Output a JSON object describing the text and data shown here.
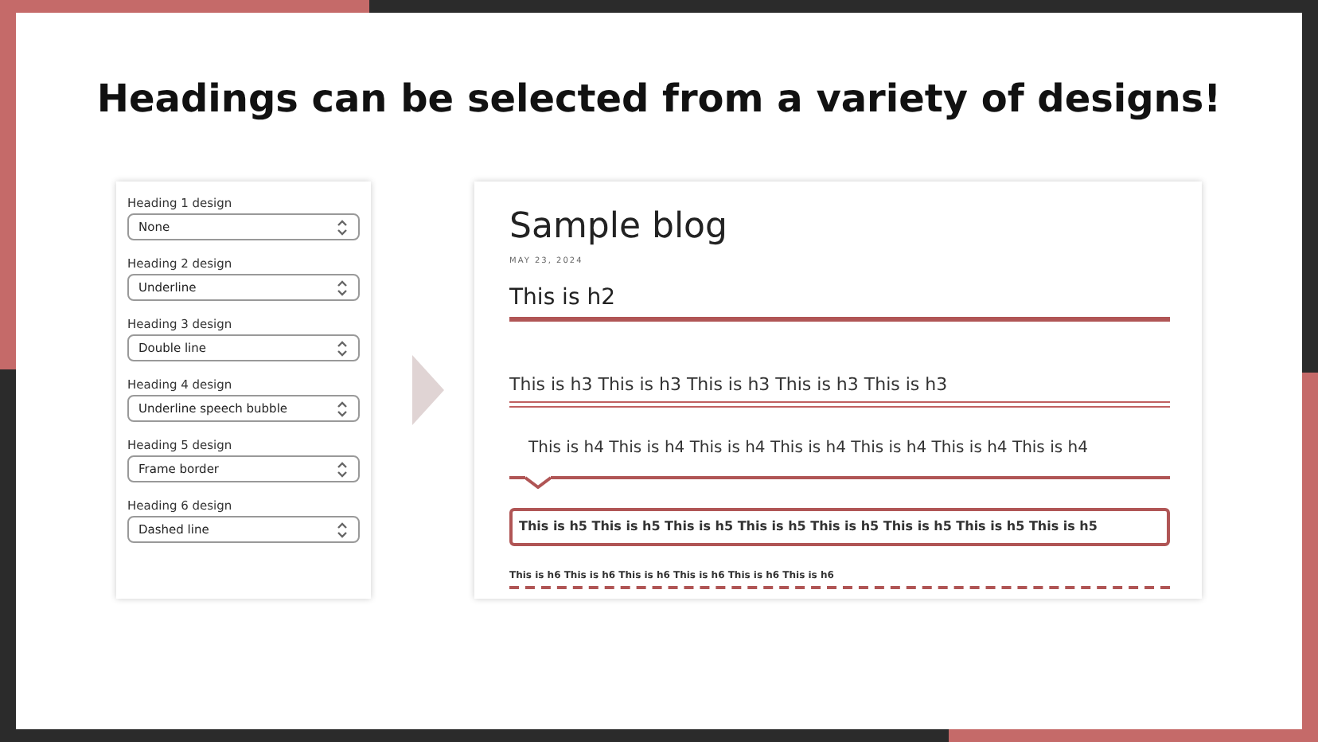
{
  "title": "Headings can be selected from a variety of designs!",
  "settings": [
    {
      "label": "Heading 1 design",
      "value": "None"
    },
    {
      "label": "Heading 2 design",
      "value": "Underline"
    },
    {
      "label": "Heading 3 design",
      "value": "Double line"
    },
    {
      "label": "Heading 4 design",
      "value": "Underline speech bubble"
    },
    {
      "label": "Heading 5 design",
      "value": "Frame border"
    },
    {
      "label": "Heading 6 design",
      "value": "Dashed line"
    }
  ],
  "preview": {
    "title": "Sample blog",
    "date": "MAY 23, 2024",
    "headings": [
      {
        "kind": "underline",
        "text": "This is h2"
      },
      {
        "kind": "double",
        "text": "This is h3 This is h3 This is h3 This is h3 This is h3"
      },
      {
        "kind": "speech",
        "text": "This is h4 This is h4 This is h4 This is h4 This is h4 This is h4 This is h4"
      },
      {
        "kind": "frame",
        "text": "This is h5 This is h5 This is h5 This is h5 This is h5 This is h5 This is h5 This is h5"
      },
      {
        "kind": "dashed",
        "text": "This is h6 This is h6 This is h6 This is h6 This is h6 This is h6"
      }
    ]
  }
}
